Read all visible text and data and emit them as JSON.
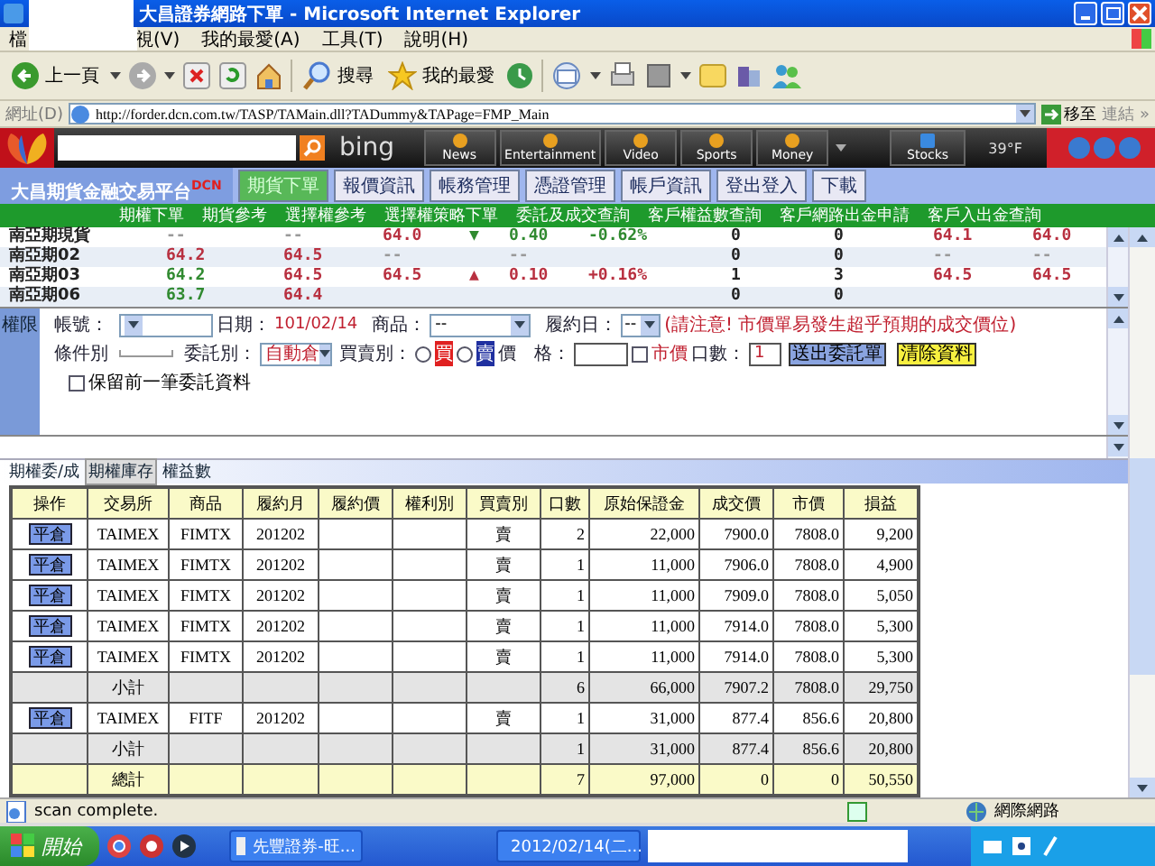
{
  "window": {
    "title": "大昌證券網路下單 - Microsoft Internet Explorer"
  },
  "menu": [
    "檔",
    "視(V)",
    "我的最愛(A)",
    "工具(T)",
    "說明(H)"
  ],
  "toolbar": {
    "back": "上一頁",
    "search": "搜尋",
    "favorites": "我的最愛"
  },
  "address": {
    "label": "網址(D)",
    "url": "http://forder.dcn.com.tw/TASP/TAMain.dll?TADummy&TAPage=FMP_Main",
    "go": "移至",
    "links": "連結 »"
  },
  "bing_bar": {
    "logo": "bing",
    "buttons": [
      "News",
      "Entertainment",
      "Video",
      "Sports",
      "Money"
    ],
    "stocks": "Stocks",
    "weather": "39°F"
  },
  "nav": {
    "brand": "大昌期貨金融交易平台",
    "brand_mark": "DCN",
    "tabs": [
      {
        "label": "期貨下單",
        "selected": true
      },
      {
        "label": "報價資訊",
        "selected": false
      },
      {
        "label": "帳務管理",
        "selected": false
      },
      {
        "label": "憑證管理",
        "selected": false
      },
      {
        "label": "帳戶資訊",
        "selected": false
      },
      {
        "label": "登出登入",
        "selected": false
      },
      {
        "label": "下載",
        "selected": false
      }
    ]
  },
  "subnav": [
    "期權下單",
    "期貨參考",
    "選擇權參考",
    "選擇權策略下單",
    "委託及成交查詢",
    "客戶權益數查詢",
    "客戶網路出金申請",
    "客戶入出金查詢"
  ],
  "quotes": [
    {
      "cells": [
        {
          "text": "南亞期現貨",
          "color": "#222222"
        },
        {
          "text": "--",
          "color": "#999999"
        },
        {
          "text": "--",
          "color": "#999999"
        },
        {
          "text": "64.0",
          "color": "#b83040"
        },
        {
          "text": "▼",
          "color": "#308a30"
        },
        {
          "text": "0.40",
          "color": "#308a30"
        },
        {
          "text": "-0.62%",
          "color": "#308a30"
        },
        {
          "text": "0",
          "color": "#222222"
        },
        {
          "text": "0",
          "color": "#222222"
        },
        {
          "text": "64.1",
          "color": "#b83040"
        },
        {
          "text": "64.0",
          "color": "#b83040"
        }
      ]
    },
    {
      "cells": [
        {
          "text": "南亞期02",
          "color": "#222222"
        },
        {
          "text": "64.2",
          "color": "#b83040"
        },
        {
          "text": "64.5",
          "color": "#b83040"
        },
        {
          "text": "--",
          "color": "#999999"
        },
        null,
        {
          "text": "--",
          "color": "#999999"
        },
        null,
        {
          "text": "0",
          "color": "#222222"
        },
        {
          "text": "0",
          "color": "#222222"
        },
        {
          "text": "--",
          "color": "#999999"
        },
        {
          "text": "--",
          "color": "#999999"
        }
      ]
    },
    {
      "cells": [
        {
          "text": "南亞期03",
          "color": "#222222"
        },
        {
          "text": "64.2",
          "color": "#308a30"
        },
        {
          "text": "64.5",
          "color": "#b83040"
        },
        {
          "text": "64.5",
          "color": "#b83040"
        },
        {
          "text": "▲",
          "color": "#b83040"
        },
        {
          "text": "0.10",
          "color": "#b83040"
        },
        {
          "text": "+0.16%",
          "color": "#b83040"
        },
        {
          "text": "1",
          "color": "#222222"
        },
        {
          "text": "3",
          "color": "#222222"
        },
        {
          "text": "64.5",
          "color": "#b83040"
        },
        {
          "text": "64.5",
          "color": "#b83040"
        }
      ]
    },
    {
      "cells": [
        {
          "text": "南亞期06",
          "color": "#222222"
        },
        {
          "text": "63.7",
          "color": "#308a30"
        },
        {
          "text": "64.4",
          "color": "#b83040"
        },
        null,
        null,
        null,
        null,
        {
          "text": "0",
          "color": "#222222"
        },
        {
          "text": "0",
          "color": "#222222"
        },
        null,
        null
      ]
    }
  ],
  "order_form": {
    "panel_label": "權限",
    "account_label": "帳號：",
    "date_label": "日期：",
    "date": "101/02/14",
    "product_label": "商品：",
    "product": "--",
    "expiry_label": "履約日：",
    "expiry": "--",
    "warning": "(請注意! 市價單易發生超乎預期的成交價位)",
    "condition_label": "條件別",
    "order_type_label": "委託別：",
    "order_type": "自動倉",
    "side_label": "買賣別：",
    "sides": [
      {
        "label": "買",
        "selected": false
      },
      {
        "label": "賣",
        "selected": false
      }
    ],
    "price_label": "價　格：",
    "market": {
      "label": "市價",
      "checked": false
    },
    "qty_label": "口數：",
    "qty": "1",
    "submit": "送出委託單",
    "clear": "清除資料",
    "keep": {
      "label": "保留前一筆委託資料",
      "checked": false
    }
  },
  "position_tabs": [
    {
      "label": "期權委/成",
      "selected": false
    },
    {
      "label": "期權庫存",
      "selected": true
    },
    {
      "label": "權益數",
      "selected": false
    }
  ],
  "table": {
    "columns": [
      "操作",
      "交易所",
      "商品",
      "履約月",
      "履約價",
      "權利別",
      "買賣別",
      "口數",
      "原始保證金",
      "成交價",
      "市價",
      "損益"
    ],
    "rows": [
      {
        "kind": "position",
        "cells": [
          "平倉",
          "TAIMEX",
          "FIMTX",
          "201202",
          null,
          null,
          "賣",
          "2",
          "22,000",
          "7900.0",
          "7808.0",
          "9,200"
        ]
      },
      {
        "kind": "position",
        "cells": [
          "平倉",
          "TAIMEX",
          "FIMTX",
          "201202",
          null,
          null,
          "賣",
          "1",
          "11,000",
          "7906.0",
          "7808.0",
          "4,900"
        ]
      },
      {
        "kind": "position",
        "cells": [
          "平倉",
          "TAIMEX",
          "FIMTX",
          "201202",
          null,
          null,
          "賣",
          "1",
          "11,000",
          "7909.0",
          "7808.0",
          "5,050"
        ]
      },
      {
        "kind": "position",
        "cells": [
          "平倉",
          "TAIMEX",
          "FIMTX",
          "201202",
          null,
          null,
          "賣",
          "1",
          "11,000",
          "7914.0",
          "7808.0",
          "5,300"
        ]
      },
      {
        "kind": "position",
        "cells": [
          "平倉",
          "TAIMEX",
          "FIMTX",
          "201202",
          null,
          null,
          "賣",
          "1",
          "11,000",
          "7914.0",
          "7808.0",
          "5,300"
        ]
      },
      {
        "kind": "subtotal",
        "cells": [
          null,
          "小計",
          null,
          null,
          null,
          null,
          null,
          "6",
          "66,000",
          "7907.2",
          "7808.0",
          "29,750"
        ]
      },
      {
        "kind": "position",
        "cells": [
          "平倉",
          "TAIMEX",
          "FITF",
          "201202",
          null,
          null,
          "賣",
          "1",
          "31,000",
          "877.4",
          "856.6",
          "20,800"
        ]
      },
      {
        "kind": "subtotal",
        "cells": [
          null,
          "小計",
          null,
          null,
          null,
          null,
          null,
          "1",
          "31,000",
          "877.4",
          "856.6",
          "20,800"
        ]
      },
      {
        "kind": "total",
        "cells": [
          null,
          "總計",
          null,
          null,
          null,
          null,
          null,
          "7",
          "97,000",
          "0",
          "0",
          "50,550"
        ]
      }
    ]
  },
  "status_bar": {
    "text": "scan complete.",
    "zone": "網際網路"
  },
  "taskbar": {
    "start": "開始",
    "tasks": [
      "先豐證券-旺...",
      "2012/02/14(二..."
    ]
  }
}
